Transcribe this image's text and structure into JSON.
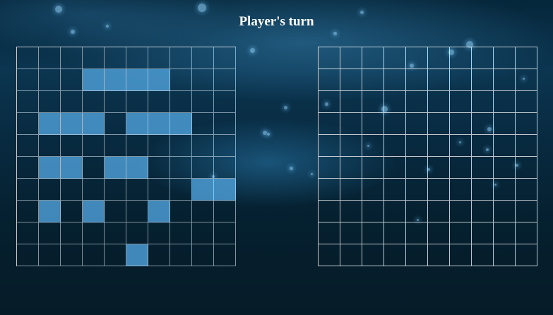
{
  "status": {
    "turn_text": "Player's turn"
  },
  "boards": {
    "size": 10,
    "player": {
      "ships": [
        [
          1,
          3
        ],
        [
          1,
          4
        ],
        [
          1,
          5
        ],
        [
          1,
          6
        ],
        [
          3,
          1
        ],
        [
          3,
          2
        ],
        [
          3,
          3
        ],
        [
          3,
          5
        ],
        [
          3,
          6
        ],
        [
          3,
          7
        ],
        [
          5,
          1
        ],
        [
          5,
          2
        ],
        [
          5,
          4
        ],
        [
          5,
          5
        ],
        [
          6,
          8
        ],
        [
          6,
          9
        ],
        [
          7,
          1
        ],
        [
          7,
          3
        ],
        [
          7,
          6
        ],
        [
          9,
          5
        ]
      ]
    },
    "enemy": {
      "ships": []
    }
  },
  "colors": {
    "ship": "#4b9bd2",
    "grid_line": "#ffffff",
    "text": "#ffffff"
  }
}
